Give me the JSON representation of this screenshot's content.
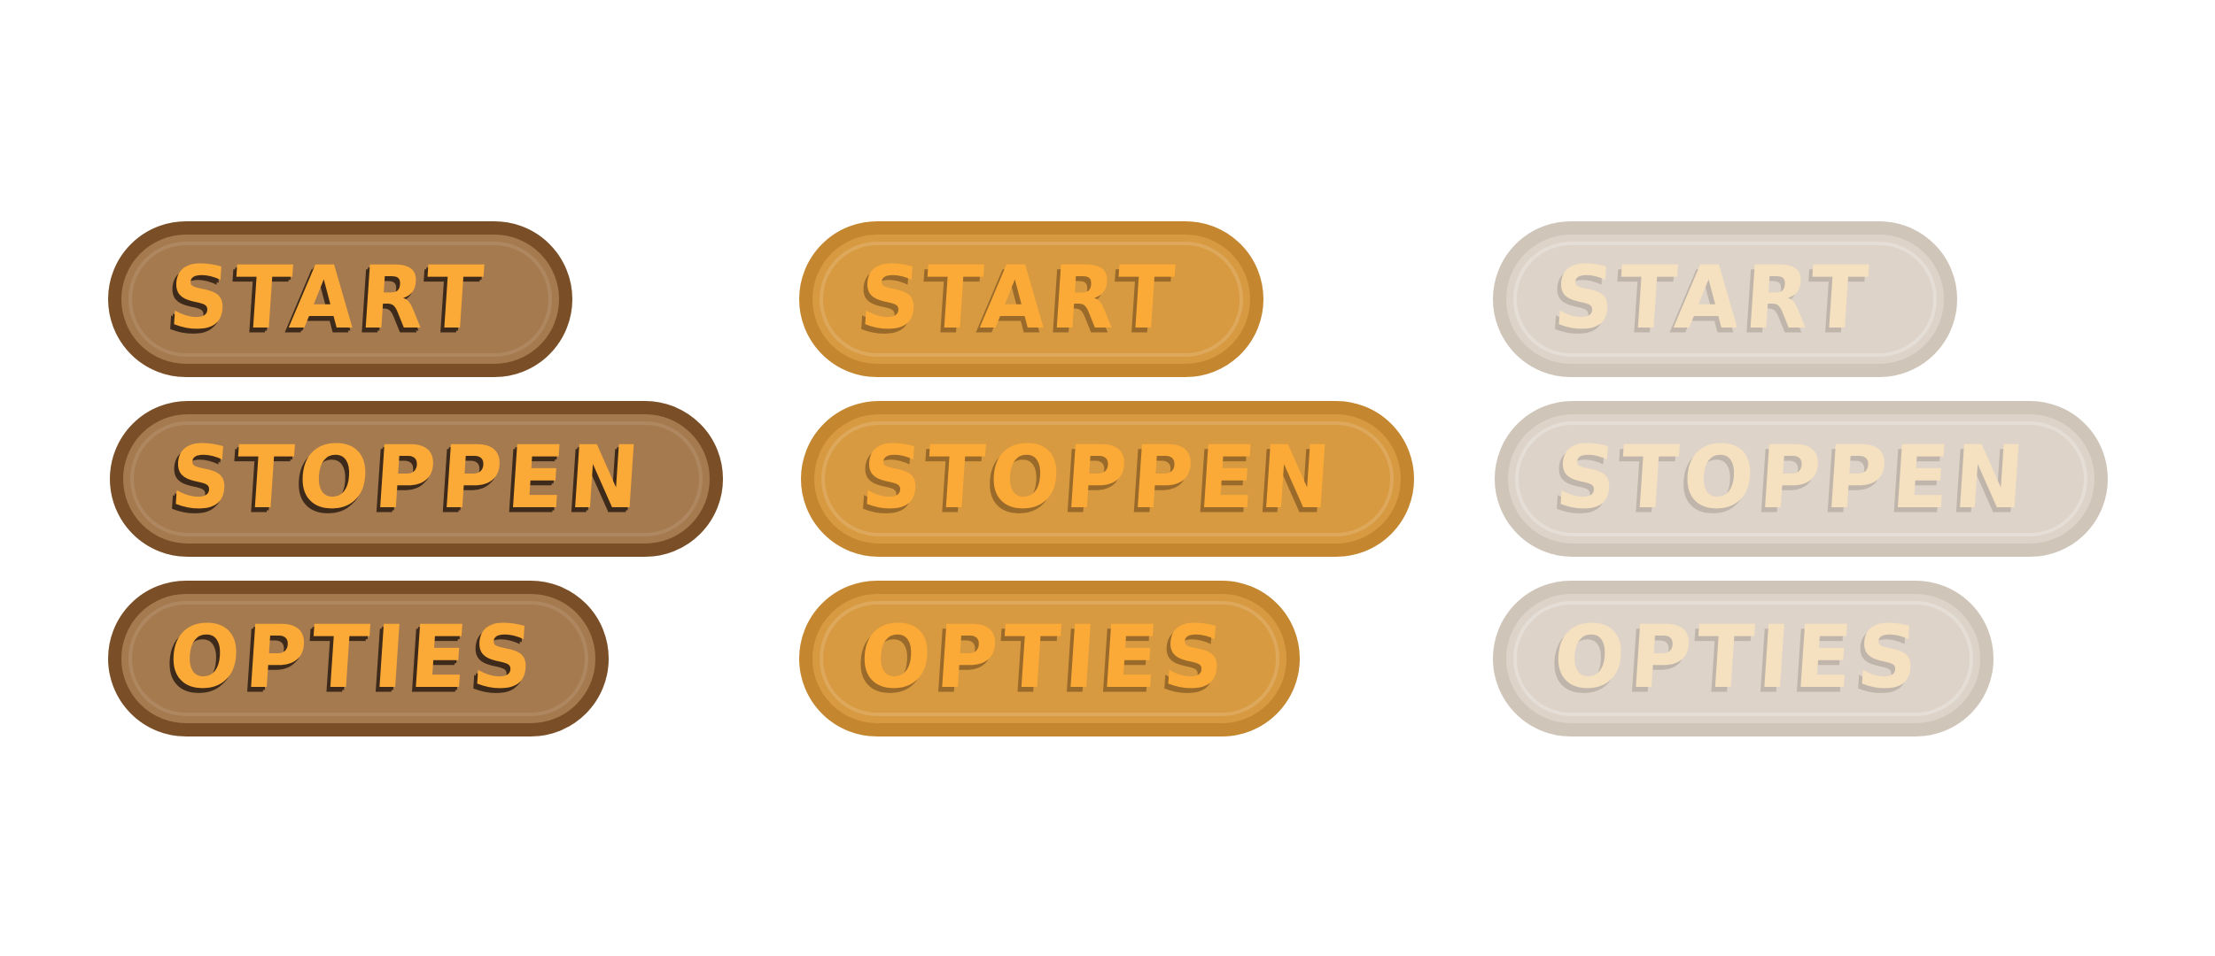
{
  "columns": [
    {
      "state": "dark",
      "buttons": [
        {
          "label": "START"
        },
        {
          "label": "STOPPEN"
        },
        {
          "label": "OPTIES"
        }
      ]
    },
    {
      "state": "normal",
      "buttons": [
        {
          "label": "START"
        },
        {
          "label": "STOPPEN"
        },
        {
          "label": "OPTIES"
        }
      ]
    },
    {
      "state": "disabled",
      "buttons": [
        {
          "label": "START"
        },
        {
          "label": "STOPPEN"
        },
        {
          "label": "OPTIES"
        }
      ]
    }
  ],
  "colors": {
    "dark_fill": "#a57a4f",
    "dark_border": "#7a4f27",
    "normal_fill": "#d89a40",
    "normal_border": "#c4862e",
    "disabled_fill": "#ddd3c8",
    "disabled_border": "#cfc5b9",
    "label_text": "#fbaa37",
    "disabled_text": "#f5e0c0"
  }
}
